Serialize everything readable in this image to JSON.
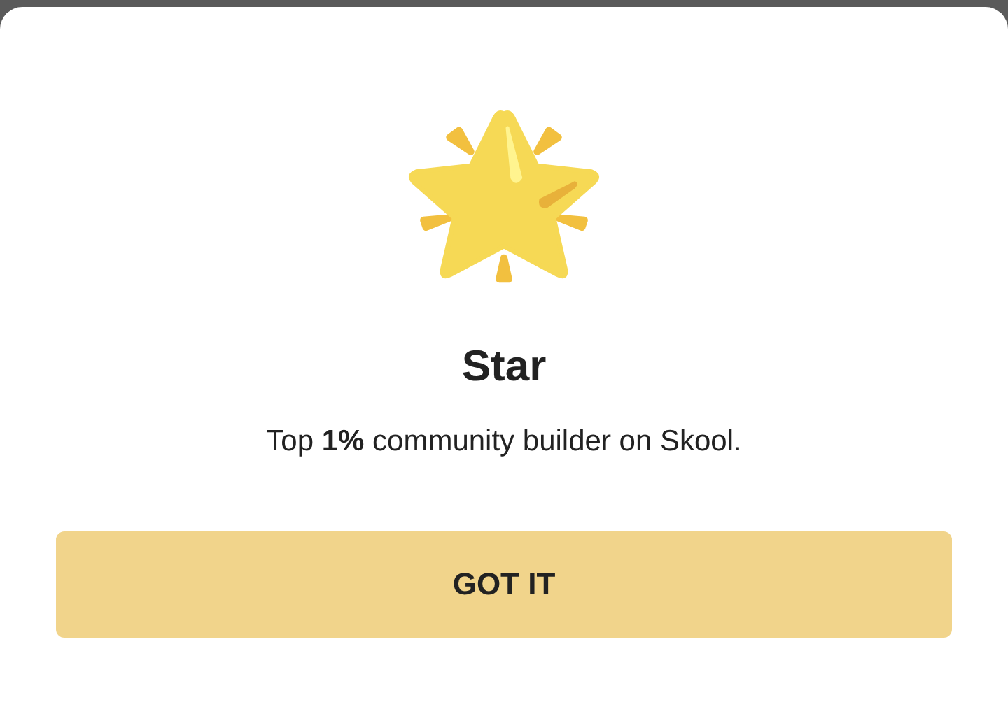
{
  "dialog": {
    "title": "Star",
    "description": "Top **1%** community builder on Skool.",
    "button": "GOT IT"
  }
}
